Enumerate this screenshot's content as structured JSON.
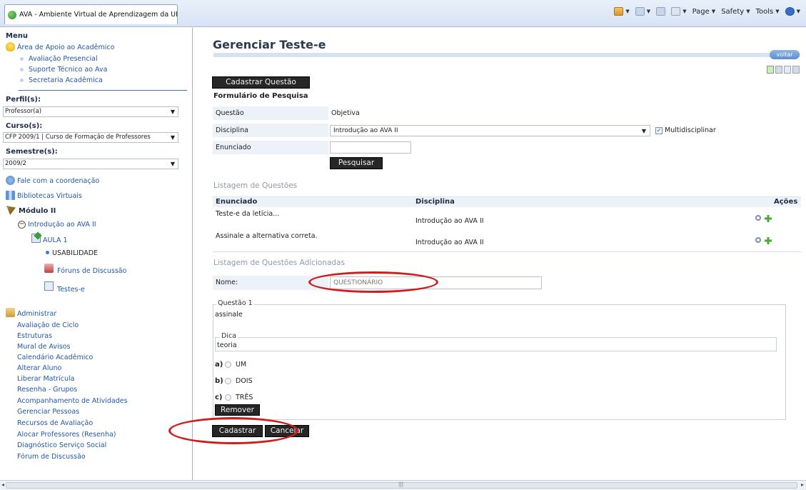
{
  "browser": {
    "tab_title": "AVA - Ambiente Virtual de Aprendizagem da UNI...",
    "commands": {
      "page": "Page",
      "safety": "Safety",
      "tools": "Tools"
    }
  },
  "sidebar": {
    "menu_title": "Menu",
    "apoio": {
      "title": "Área de Apoio ao Acadêmico",
      "items": [
        "Avaliação Presencial",
        "Suporte Técnico ao Ava",
        "Secretaria Acadêmica"
      ]
    },
    "perfil": {
      "label": "Perfil(s):",
      "value": "Professor(a)"
    },
    "curso": {
      "label": "Curso(s):",
      "value": "CFP 2009/1 | Curso de Formação de Professores"
    },
    "semestre": {
      "label": "Semestre(s):",
      "value": "2009/2"
    },
    "fale": "Fale com a coordenação",
    "bibliotecas": "Bibliotecas Virtuais",
    "modulo": "Módulo II",
    "disciplina": "Introdução ao AVA II",
    "aula": "AULA 1",
    "usabilidade": "USABILIDADE",
    "foruns": "Fóruns de Discussão",
    "testes": "Testes-e",
    "administrar": {
      "title": "Administrar",
      "items": [
        "Avaliação de Ciclo",
        "Estruturas",
        "Mural de Avisos",
        "Calendário Acadêmico",
        "Alterar Aluno",
        "Liberar Matrícula",
        "Resenha - Grupos",
        "Acompanhamento de Atividades",
        "Gerenciar Pessoas",
        "Recursos de Avaliação",
        "Alocar Professores (Resenha)",
        "Diagnóstico Serviço Social",
        "Fórum de Discussão"
      ]
    }
  },
  "main": {
    "title": "Gerenciar Teste-e",
    "voltar": "voltar",
    "cadastrar_questao": "Cadastrar Questão",
    "form_title": "Formulário de Pesquisa",
    "questao": {
      "label": "Questão",
      "value": "Objetiva"
    },
    "disciplina": {
      "label": "Disciplina",
      "value": "Introdução ao AVA II",
      "multi_label": "Multidisciplinar",
      "multi_checked": true
    },
    "enunciado": {
      "label": "Enunciado",
      "value": ""
    },
    "pesquisar": "Pesquisar",
    "listagem_title": "Listagem de Questões",
    "table": {
      "headers": [
        "Enunciado",
        "Disciplina",
        "Ações"
      ],
      "rows": [
        {
          "enunciado": "Teste-e da letícia...",
          "disciplina": "Introdução ao AVA II"
        },
        {
          "enunciado": "Assinale a alternativa correta.",
          "disciplina": "Introdução ao AVA II"
        }
      ]
    },
    "adicionadas_title": "Listagem de Questões Adicionadas",
    "nome": {
      "label": "Nome:",
      "value": "QUESTIONÁRIO"
    },
    "questao1": {
      "legend": "Questão 1",
      "enunciado": "assinale",
      "dica_legend": "Dica",
      "dica_text": "teoria",
      "options": [
        {
          "letter": "a)",
          "text": "UM"
        },
        {
          "letter": "b)",
          "text": "DOIS"
        },
        {
          "letter": "c)",
          "text": "TRÊS"
        }
      ],
      "remover": "Remover"
    },
    "cadastrar": "Cadastrar",
    "cancelar": "Cancelar"
  }
}
